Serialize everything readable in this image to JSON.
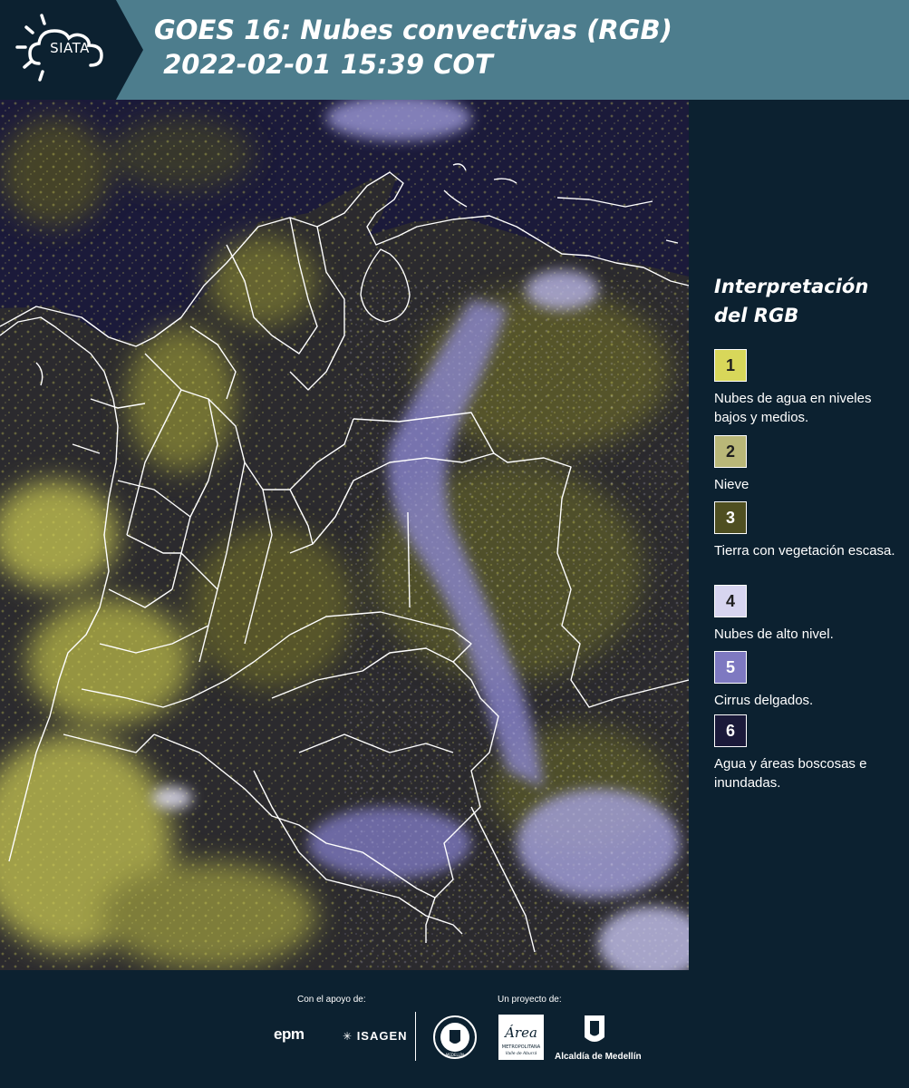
{
  "header": {
    "brand": "SIATA",
    "title_line1": "GOES 16: Nubes convectivas (RGB)",
    "title_line2": " 2022-02-01 15:39 COT"
  },
  "legend": {
    "title": "Interpretación del RGB",
    "items": [
      {
        "number": "1",
        "label": "Nubes de agua en niveles bajos y medios.",
        "color": "#d8d75a",
        "text_color": "#1e1e1e"
      },
      {
        "number": "2",
        "label": "Nieve",
        "color": "#b9b778",
        "text_color": "#1e1e1e"
      },
      {
        "number": "3",
        "label": "Tierra con vegetación escasa.",
        "color": "#4f4f21",
        "text_color": "#ffffff"
      },
      {
        "number": "4",
        "label": "Nubes de alto nivel.",
        "color": "#d7d5f0",
        "text_color": "#1e1e1e"
      },
      {
        "number": "5",
        "label": "Cirrus delgados.",
        "color": "#7e79c1",
        "text_color": "#ffffff"
      },
      {
        "number": "6",
        "label": "Agua y áreas boscosas e inundadas.",
        "color": "#1b1a3a",
        "text_color": "#ffffff"
      }
    ]
  },
  "footer": {
    "support_caption": "Con el apoyo de:",
    "project_caption": "Un proyecto de:",
    "sponsors": [
      "epm",
      "ISAGEN"
    ],
    "partner_alcaldia": "Alcaldía de Medellín",
    "logo_wordmarks": [
      "Área",
      "METROPOLITANA",
      "Valle de Aburrá",
      "MEDELLÍN"
    ]
  },
  "colors": {
    "header_bg": "#4d7d8d",
    "page_bg": "#0c2130",
    "ocean_bg": "#1b1a3a",
    "land": "#2a2a3a",
    "low_cloud": "#d8d75a",
    "high_cloud": "#d7d5f0",
    "boundary": "#ffffff"
  }
}
